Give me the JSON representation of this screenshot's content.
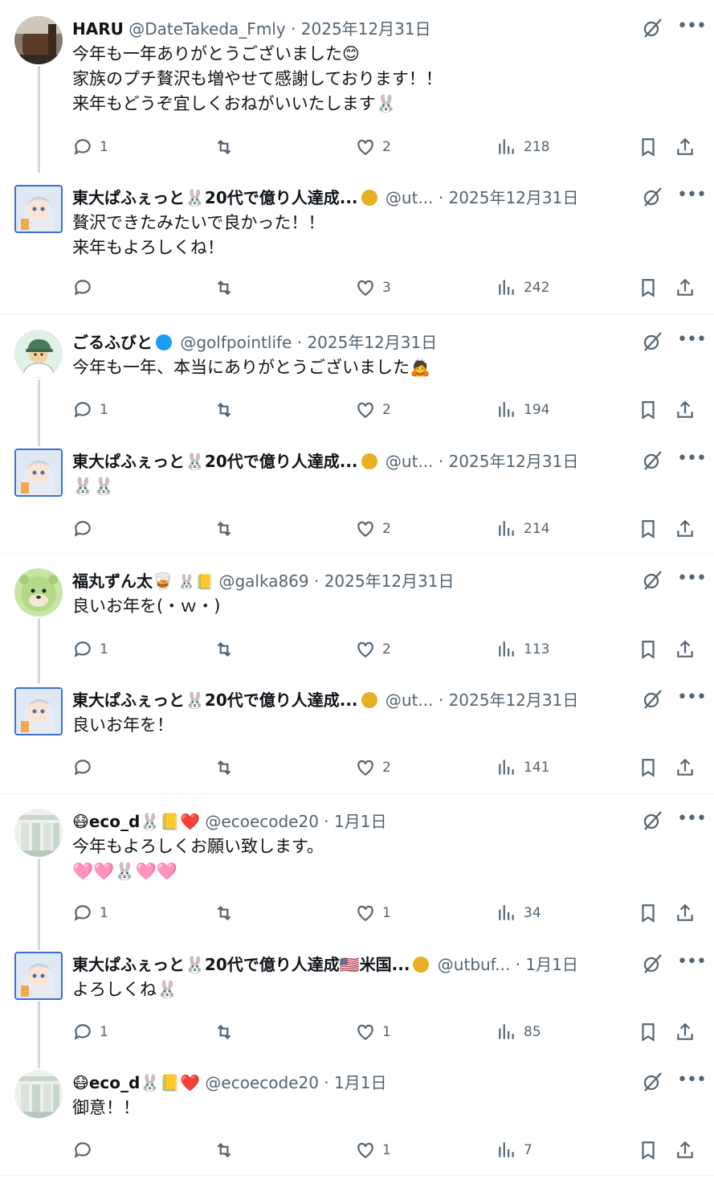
{
  "tweets": [
    {
      "name": "HARU",
      "badge": "",
      "extra": "",
      "handle": "@DateTakeda_Fmly",
      "dot": "·",
      "date": "2025年12月31日",
      "text": "今年も一年ありがとうございました😊\n家族のプチ贅沢も増やせて感謝しております！！\n来年もどうぞ宜しくおねがいいたします🐰",
      "replies": "1",
      "likes": "2",
      "views": "218",
      "avatar": "photo-avatar"
    },
    {
      "name": "東大ぱふぇっと🐰20代で億り人達成...",
      "badge": "gold",
      "extra": "",
      "handle": "@ut...",
      "dot": "·",
      "date": "2025年12月31日",
      "text": "贅沢できたみたいで良かった！！\n来年もよろしくね！",
      "replies": "",
      "likes": "3",
      "views": "242",
      "avatar": "anime-avatar"
    },
    {
      "name": "ごるふびと",
      "badge": "blue",
      "extra": "",
      "handle": "@golfpointlife",
      "dot": "·",
      "date": "2025年12月31日",
      "text": "今年も一年、本当にありがとうございました🙇",
      "replies": "1",
      "likes": "2",
      "views": "194",
      "avatar": "golfer-avatar"
    },
    {
      "name": "東大ぱふぇっと🐰20代で億り人達成...",
      "badge": "gold",
      "extra": "",
      "handle": "@ut...",
      "dot": "·",
      "date": "2025年12月31日",
      "text": "🐰🐰",
      "replies": "",
      "likes": "2",
      "views": "214",
      "avatar": "anime-avatar"
    },
    {
      "name": "福丸ずん太🥃",
      "badge": "",
      "extra": "🐰📒",
      "handle": "@galka869",
      "dot": "·",
      "date": "2025年12月31日",
      "text": "良いお年を(・ｗ・)",
      "replies": "1",
      "likes": "2",
      "views": "113",
      "avatar": "green-avatar"
    },
    {
      "name": "東大ぱふぇっと🐰20代で億り人達成...",
      "badge": "gold",
      "extra": "",
      "handle": "@ut...",
      "dot": "·",
      "date": "2025年12月31日",
      "text": "良いお年を！",
      "replies": "",
      "likes": "2",
      "views": "141",
      "avatar": "anime-avatar"
    },
    {
      "name": "😷eco_d🐰📒❤️",
      "badge": "",
      "extra": "",
      "handle": "@ecoecode20",
      "dot": "·",
      "date": "1月1日",
      "text": "今年もよろしくお願い致します。\n🩷🩷🐰🩷🩷",
      "replies": "1",
      "likes": "1",
      "views": "34",
      "avatar": "building-avatar"
    },
    {
      "name": "東大ぱふぇっと🐰20代で億り人達成🇺🇸米国...",
      "badge": "gold",
      "extra": "",
      "handle": "@utbuf...",
      "dot": "·",
      "date": "1月1日",
      "text": "よろしくね🐰",
      "replies": "1",
      "likes": "1",
      "views": "85",
      "avatar": "anime-avatar"
    },
    {
      "name": "😷eco_d🐰📒❤️",
      "badge": "",
      "extra": "",
      "handle": "@ecoecode20",
      "dot": "·",
      "date": "1月1日",
      "text": "御意！！",
      "replies": "",
      "likes": "1",
      "views": "7",
      "avatar": "building-avatar"
    }
  ],
  "colors": {
    "text": "#0f1419",
    "meta": "#536471",
    "verified_blue": "#1d9bf0",
    "verified_gold": "#e6b022",
    "thread_line": "#cfd9de",
    "separator": "#eff3f4"
  },
  "icons": {
    "reply": "reply-icon",
    "retweet": "retweet-icon",
    "like": "heart-icon",
    "views": "views-icon",
    "bookmark": "bookmark-icon",
    "share": "share-icon",
    "grok": "grok-icon",
    "more": "more-icon"
  }
}
